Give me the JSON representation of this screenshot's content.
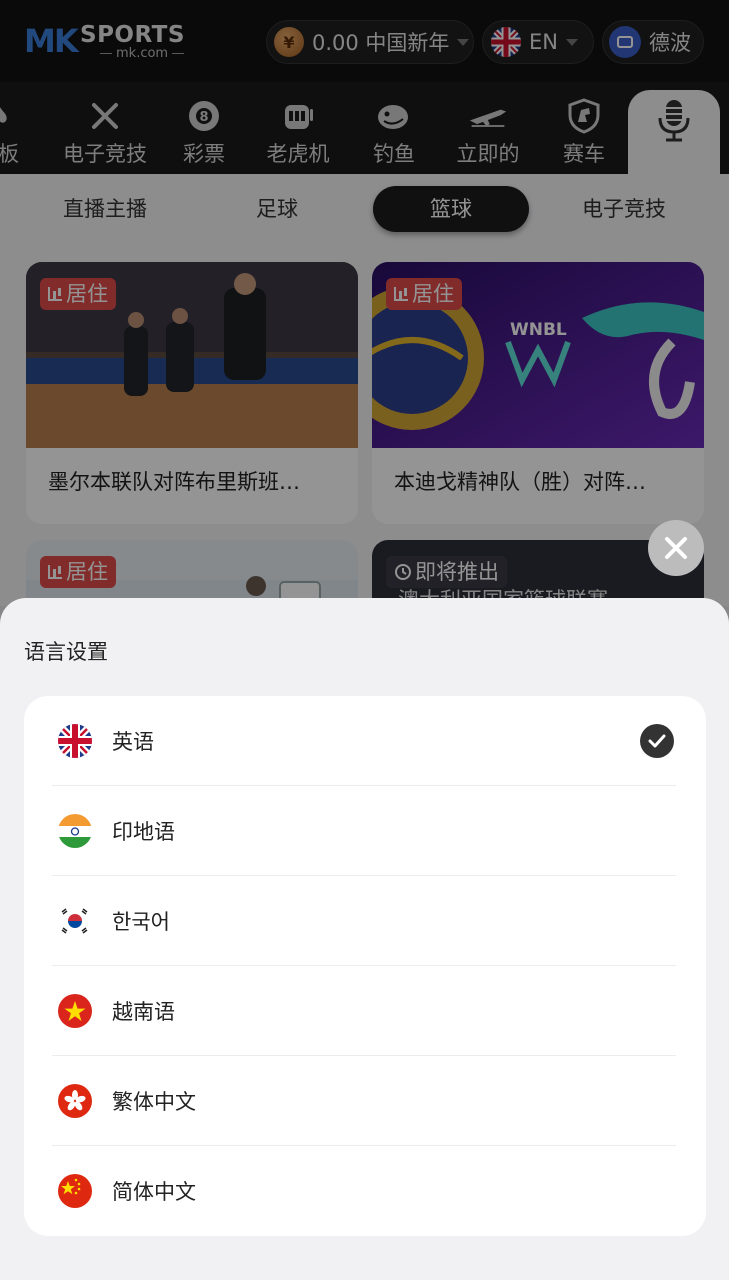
{
  "header": {
    "logo_mk": "MK",
    "logo_sports": "SPORTS",
    "logo_domain": "mk.com",
    "balance": "0.00 中国新年",
    "language_code": "EN",
    "wallet_label": "德波"
  },
  "categories": [
    {
      "label": "木板",
      "icon": "spade-icon"
    },
    {
      "label": "电子竞技",
      "icon": "swords-icon"
    },
    {
      "label": "彩票",
      "icon": "lottery-ball-icon"
    },
    {
      "label": "老虎机",
      "icon": "slot-machine-icon"
    },
    {
      "label": "钓鱼",
      "icon": "fish-icon"
    },
    {
      "label": "立即的",
      "icon": "jet-icon"
    },
    {
      "label": "赛车",
      "icon": "shield-horse-icon"
    },
    {
      "label": "",
      "icon": "microphone-icon"
    }
  ],
  "subtabs": [
    "直播主播",
    "足球",
    "篮球",
    "电子竞技"
  ],
  "active_subtab": "篮球",
  "cards": [
    {
      "badge": "居住",
      "badge_type": "live",
      "title": "墨尔本联队对阵布里斯班…"
    },
    {
      "badge": "居住",
      "badge_type": "live",
      "title": "本迪戈精神队（胜）对阵…",
      "logo_text": "WNBL"
    },
    {
      "badge": "居住",
      "badge_type": "live",
      "title": ""
    },
    {
      "badge": "即将推出",
      "badge_type": "soon",
      "title": "澳大利亚国家篮球联赛"
    }
  ],
  "sheet": {
    "title": "语言设置",
    "languages": [
      {
        "label": "英语",
        "flag": "uk-flag-icon",
        "selected": true
      },
      {
        "label": "印地语",
        "flag": "india-flag-icon",
        "selected": false
      },
      {
        "label": "한국어",
        "flag": "korea-flag-icon",
        "selected": false
      },
      {
        "label": "越南语",
        "flag": "vietnam-flag-icon",
        "selected": false
      },
      {
        "label": "繁体中文",
        "flag": "hongkong-flag-icon",
        "selected": false
      },
      {
        "label": "简体中文",
        "flag": "china-flag-icon",
        "selected": false
      }
    ]
  },
  "colors": {
    "live_badge": "#e04a4a",
    "accent_blue": "#3b7fd9",
    "dark": "#1d1d1d"
  }
}
